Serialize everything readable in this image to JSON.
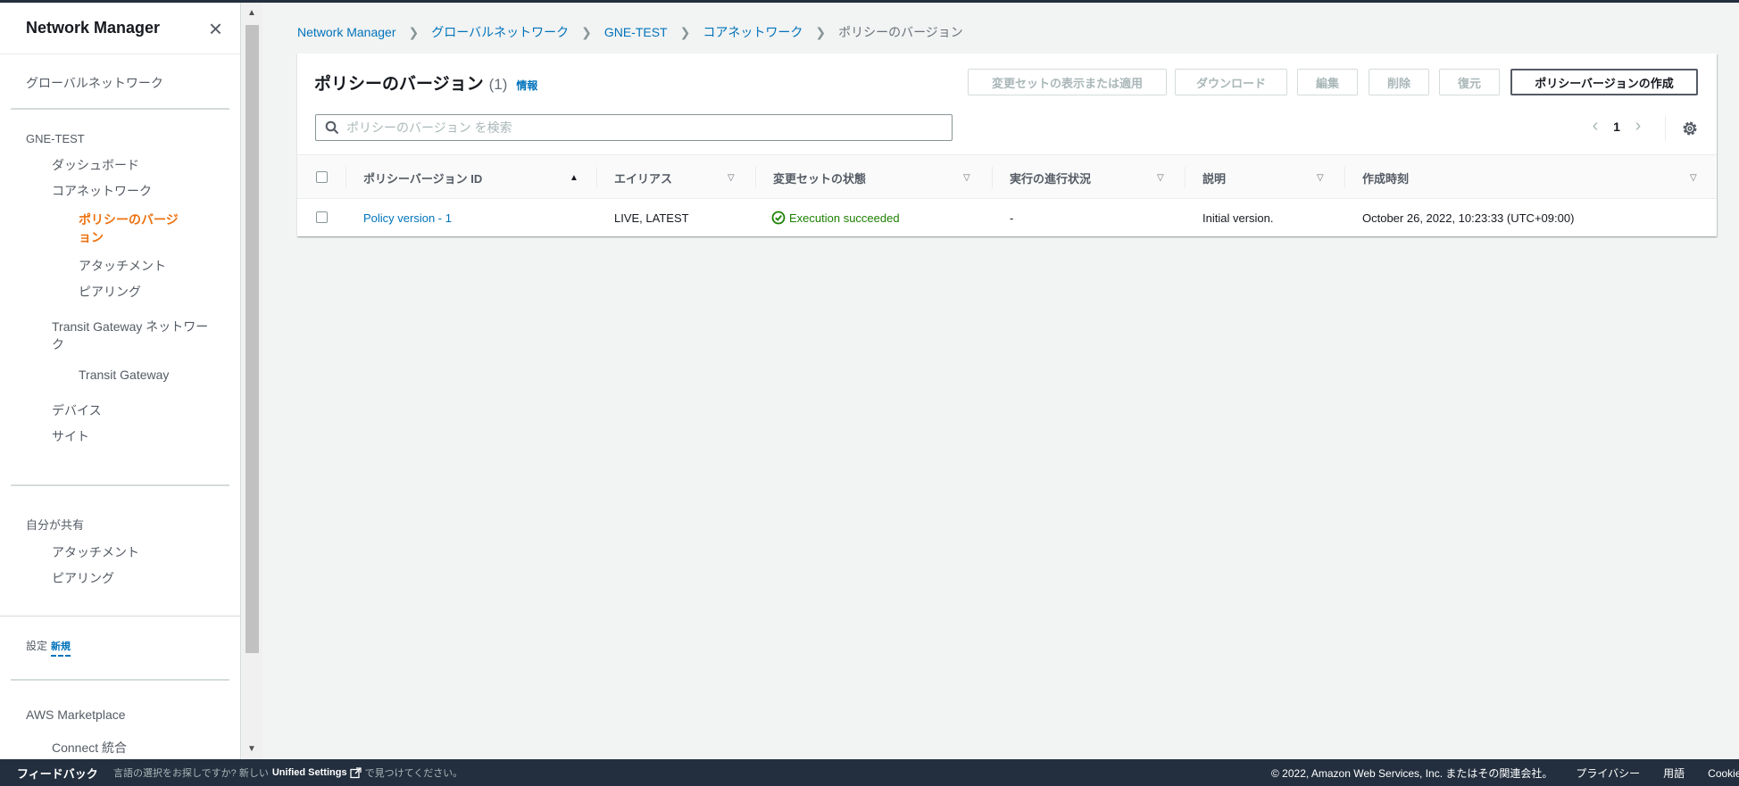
{
  "sidebar": {
    "title": "Network Manager",
    "global_networks": "グローバルネットワーク",
    "network_name": "GNE-TEST",
    "dashboard": "ダッシュボード",
    "core_network": "コアネットワーク",
    "policy_versions": "ポリシーのバージョン",
    "attachments": "アタッチメント",
    "peering": "ピアリング",
    "tgw_network": "Transit Gateway ネットワーク",
    "tgw": "Transit Gateway",
    "devices": "デバイス",
    "sites": "サイト",
    "shared_with_me": "自分が共有",
    "shared_attachments": "アタッチメント",
    "shared_peering": "ピアリング",
    "settings": "設定",
    "settings_badge": "新規",
    "marketplace": "AWS Marketplace",
    "connect_integration": "Connect 統合"
  },
  "breadcrumb": {
    "items": [
      "Network Manager",
      "グローバルネットワーク",
      "GNE-TEST",
      "コアネットワーク"
    ],
    "current": "ポリシーのバージョン"
  },
  "panel": {
    "title": "ポリシーのバージョン",
    "count": "(1)",
    "info": "情報",
    "buttons": {
      "view_apply": "変更セットの表示または適用",
      "download": "ダウンロード",
      "edit": "編集",
      "delete": "削除",
      "restore": "復元",
      "create": "ポリシーバージョンの作成"
    },
    "search_placeholder": "ポリシーのバージョン を検索",
    "page": "1"
  },
  "table": {
    "headers": {
      "id": "ポリシーバージョン ID",
      "alias": "エイリアス",
      "changeset": "変更セットの状態",
      "progress": "実行の進行状況",
      "description": "説明",
      "created": "作成時刻"
    },
    "rows": [
      {
        "id": "Policy version - 1",
        "alias": "LIVE, LATEST",
        "changeset": "Execution succeeded",
        "progress": "-",
        "description": "Initial version.",
        "created": "October 26, 2022, 10:23:33 (UTC+09:00)"
      }
    ]
  },
  "footer": {
    "feedback": "フィードバック",
    "lang_prefix": "言語の選択をお探しですか? 新しい",
    "unified_settings": "Unified Settings",
    "lang_suffix": "で見つけてください。",
    "copyright": "© 2022, Amazon Web Services, Inc. またはその関連会社。",
    "privacy": "プライバシー",
    "terms": "用語",
    "cookie": "Cookie の設定"
  },
  "colors": {
    "accent": "#ec7211",
    "link": "#0073bb",
    "success": "#1d8102",
    "footer_bg": "#232f3e"
  },
  "icons": [
    "close-icon",
    "search-icon",
    "gear-icon",
    "chevron-right-icon",
    "sort-ascending-icon",
    "sort-descending-icon",
    "status-success-icon",
    "external-link-icon"
  ]
}
